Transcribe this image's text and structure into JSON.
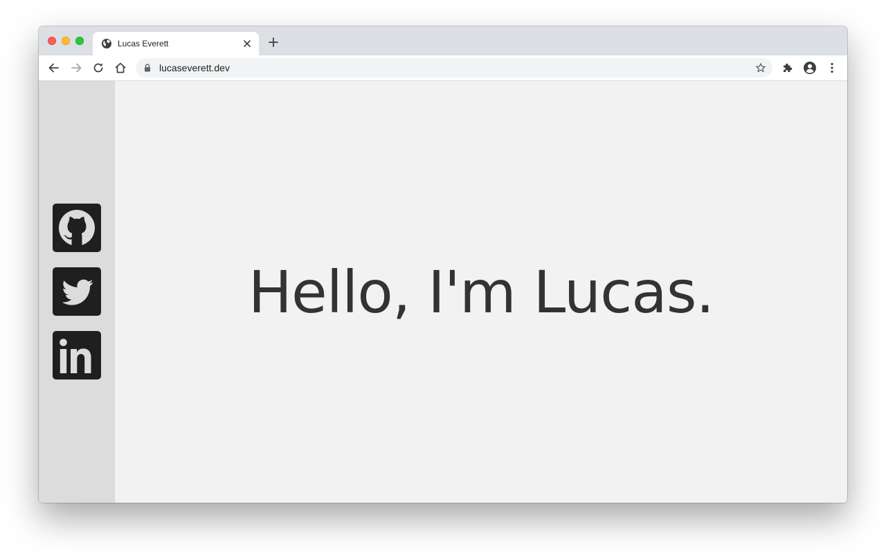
{
  "browser": {
    "tab": {
      "title": "Lucas Everett",
      "favicon": "globe-icon"
    },
    "address_bar": {
      "url": "lucaseverett.dev",
      "secure_icon": "lock-icon"
    },
    "toolbar_icons": [
      "back-arrow-icon",
      "forward-arrow-icon",
      "reload-icon",
      "home-icon",
      "bookmark-star-icon",
      "extensions-puzzle-icon",
      "profile-avatar-icon",
      "menu-kebab-icon"
    ]
  },
  "page": {
    "hero_text": "Hello, I'm Lucas.",
    "social_links": [
      {
        "name": "GitHub",
        "icon": "github-icon"
      },
      {
        "name": "Twitter",
        "icon": "twitter-icon"
      },
      {
        "name": "LinkedIn",
        "icon": "linkedin-icon"
      }
    ],
    "colors": {
      "sidebar_bg": "#dcdcdc",
      "content_bg": "#f2f2f2",
      "icon_tile": "#1f1f1f",
      "hero_text": "#333333"
    }
  }
}
